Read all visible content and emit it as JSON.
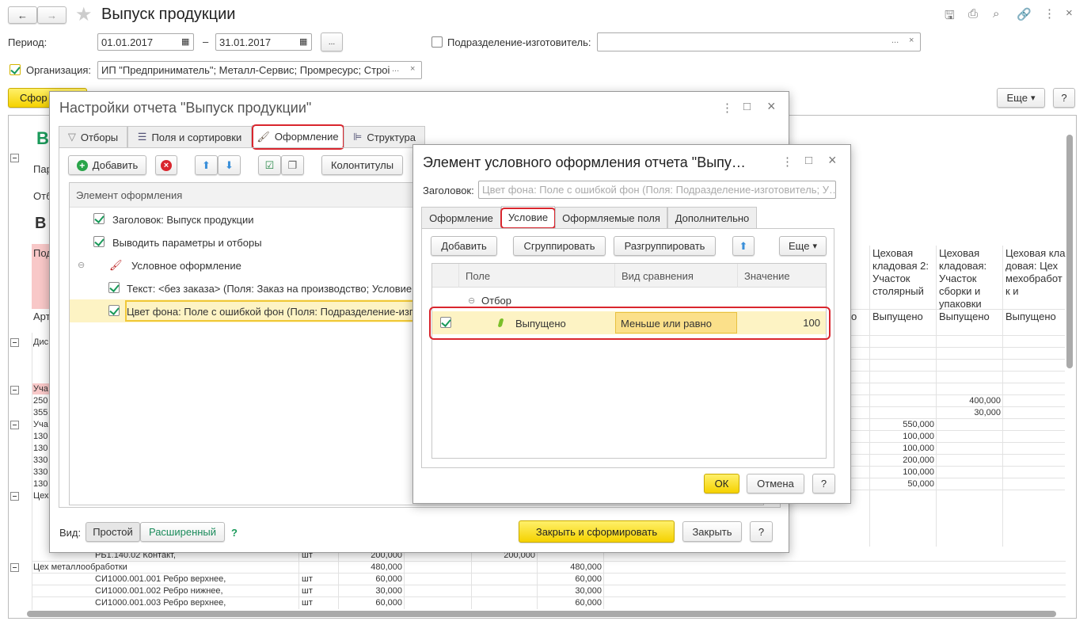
{
  "window": {
    "title": "Выпуск продукции",
    "back": "←",
    "forward": "→"
  },
  "filters": {
    "period_label": "Период:",
    "date_from": "01.01.2017",
    "date_to": "31.01.2017",
    "dash": "–",
    "ellipsis": "...",
    "subdivision_label": "Подразделение-изготовитель:",
    "subdivision_value": "",
    "subdivision_checked": false,
    "org_label": "Организация:",
    "org_value": "ИП \"Предприниматель\"; Металл-Сервис; Промресурс; Строі",
    "org_checked": true,
    "clear": "×"
  },
  "toolbar": {
    "generate": "Сфор",
    "more": "Еще",
    "help": "?"
  },
  "report": {
    "left_fragments": [
      "В",
      "Пар",
      "Отб",
      "В",
      "Под",
      "Арт",
      "Дис",
      "Уча",
      "250",
      "355",
      "Уча",
      "130",
      "130",
      "330",
      "330",
      "130",
      "Цех"
    ],
    "columns": [
      {
        "header": "Цеховая кладовая 2: Участок столярный",
        "sub": "Выпущено"
      },
      {
        "header": "Цеховая кладовая: Участок сборки и упаковки",
        "sub": "Выпущено"
      },
      {
        "header": "Цеховая кладовая: Цех мехобработк и",
        "sub": "Выпущено"
      }
    ],
    "partial_sub": "о",
    "col1_values": [
      "550,000",
      "100,000",
      "100,000",
      "200,000",
      "100,000",
      "50,000"
    ],
    "col2_values": [
      "400,000",
      "30,000"
    ],
    "bottom_rows": [
      {
        "name": "РБ1.140.02 Контакт,",
        "unit": "шт",
        "total": "200,000",
        "v2": "200,000",
        "v3": ""
      },
      {
        "name": "Цех металлообработки",
        "unit": "",
        "total": "480,000",
        "v2": "",
        "v3": "480,000"
      },
      {
        "name": "СИ1000.001.001 Ребро верхнее,",
        "unit": "шт",
        "total": "60,000",
        "v2": "",
        "v3": "60,000"
      },
      {
        "name": "СИ1000.001.002 Ребро нижнее,",
        "unit": "шт",
        "total": "30,000",
        "v2": "",
        "v3": "30,000"
      },
      {
        "name": "СИ1000.001.003 Ребро верхнее,",
        "unit": "шт",
        "total": "60,000",
        "v2": "",
        "v3": "60,000"
      }
    ]
  },
  "settings": {
    "title": "Настройки отчета \"Выпуск продукции\"",
    "tabs": [
      "Отборы",
      "Поля и сортировки",
      "Оформление",
      "Структура"
    ],
    "active_tab": "Оформление",
    "add": "Добавить",
    "headers_footers": "Колонтитулы",
    "column_header": "Элемент оформления",
    "items": [
      {
        "label": "Заголовок: Выпуск продукции",
        "checked": true
      },
      {
        "label": "Выводить параметры и отборы",
        "checked": true
      },
      {
        "label": "Условное оформление",
        "group": true
      },
      {
        "label": "Текст: <без заказа> (Поля: Заказ на производство; Условие:",
        "checked": true
      },
      {
        "label": "Цвет фона: Поле с ошибкой фон (Поля: Подразделение-изгот",
        "checked": true,
        "selected": true
      }
    ],
    "view_label": "Вид:",
    "view_simple": "Простой",
    "view_extended": "Расширенный",
    "view_help": "?",
    "close_generate": "Закрыть и сформировать",
    "close": "Закрыть",
    "help": "?"
  },
  "element": {
    "title": "Элемент условного оформления отчета \"Выпу…",
    "caption_label": "Заголовок:",
    "caption_placeholder": "Цвет фона: Поле с ошибкой фон (Поля: Подразделение-изготовитель; У…",
    "tabs": [
      "Оформление",
      "Условие",
      "Оформляемые поля",
      "Дополнительно"
    ],
    "active_tab": "Условие",
    "add": "Добавить",
    "group": "Сгруппировать",
    "ungroup": "Разгруппировать",
    "more": "Еще",
    "columns": [
      "Поле",
      "Вид сравнения",
      "Значение"
    ],
    "group_row": "Отбор",
    "condition": {
      "field": "Выпущено",
      "comparison": "Меньше или равно",
      "value": "100",
      "checked": true
    },
    "ok": "ОК",
    "cancel": "Отмена",
    "help": "?"
  },
  "colors": {
    "accent_yellow": "#f5d200",
    "highlight_red": "#d9262e",
    "selected_row": "#fdf3c4",
    "pink": "#f8c8c8",
    "green_title": "#1a9a5a"
  }
}
